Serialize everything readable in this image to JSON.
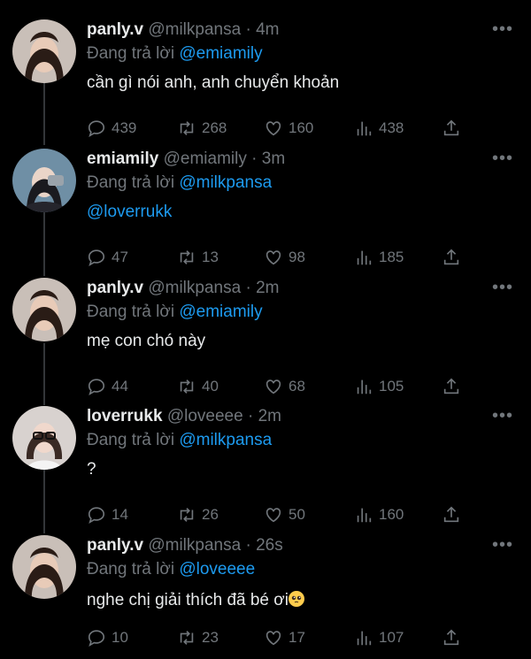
{
  "tweets": [
    {
      "name": "panly.v",
      "handle": "@milkpansa",
      "dot": "·",
      "time": "4m",
      "replying_prefix": "Đang trả lời",
      "replying_to": "@emiamily",
      "text": "cần gì nói anh, anh chuyển khoản",
      "text_is_link": false,
      "replies": "439",
      "retweets": "268",
      "likes": "160",
      "views": "438"
    },
    {
      "name": "emiamily",
      "handle": "@emiamily",
      "dot": "·",
      "time": "3m",
      "replying_prefix": "Đang trả lời",
      "replying_to": "@milkpansa",
      "text": "@loverrukk",
      "text_is_link": true,
      "replies": "47",
      "retweets": "13",
      "likes": "98",
      "views": "185"
    },
    {
      "name": "panly.v",
      "handle": "@milkpansa",
      "dot": "·",
      "time": "2m",
      "replying_prefix": "Đang trả lời",
      "replying_to": "@emiamily",
      "text": "mẹ con chó này",
      "text_is_link": false,
      "replies": "44",
      "retweets": "40",
      "likes": "68",
      "views": "105"
    },
    {
      "name": "loverrukk",
      "handle": "@loveeee",
      "dot": "·",
      "time": "2m",
      "replying_prefix": "Đang trả lời",
      "replying_to": "@milkpansa",
      "text": "?",
      "text_is_link": false,
      "replies": "14",
      "retweets": "26",
      "likes": "50",
      "views": "160"
    },
    {
      "name": "panly.v",
      "handle": "@milkpansa",
      "dot": "·",
      "time": "26s",
      "replying_prefix": "Đang trả lời",
      "replying_to": "@loveeee",
      "text": "nghe chị giải thích đã bé ơi",
      "text_is_link": false,
      "replies": "10",
      "retweets": "23",
      "likes": "17",
      "views": "107"
    }
  ],
  "more_label": "•••",
  "colors": {
    "background": "#000000",
    "text": "#e7e9ea",
    "muted": "#71767b",
    "link": "#1d9bf0"
  },
  "icons": [
    "reply-icon",
    "retweet-icon",
    "like-icon",
    "views-icon",
    "share-icon",
    "more-icon",
    "pleading-face-emoji"
  ]
}
